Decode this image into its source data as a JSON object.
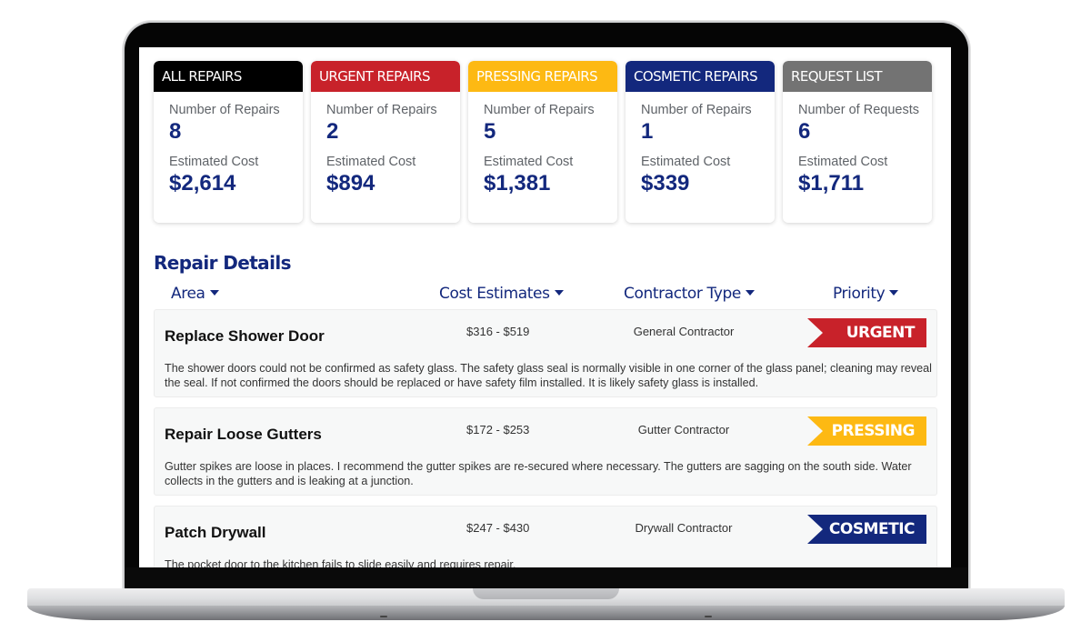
{
  "theme": {
    "all": "#000000",
    "urgent": "#c8222a",
    "pressing": "#fdb913",
    "cosmetic": "#13287d",
    "request": "#737373",
    "text_accent": "#13287d"
  },
  "summary_cards": [
    {
      "title": "ALL REPAIRS",
      "count_label": "Number of Repairs",
      "count": "8",
      "cost_label": "Estimated Cost",
      "cost": "$2,614"
    },
    {
      "title": "URGENT REPAIRS",
      "count_label": "Number of Repairs",
      "count": "2",
      "cost_label": "Estimated Cost",
      "cost": "$894"
    },
    {
      "title": "PRESSING REPAIRS",
      "count_label": "Number of Repairs",
      "count": "5",
      "cost_label": "Estimated Cost",
      "cost": "$1,381"
    },
    {
      "title": "COSMETIC REPAIRS",
      "count_label": "Number of Repairs",
      "count": "1",
      "cost_label": "Estimated Cost",
      "cost": "$339"
    },
    {
      "title": "REQUEST LIST",
      "count_label": "Number of Requests",
      "count": "6",
      "cost_label": "Estimated Cost",
      "cost": "$1,711"
    }
  ],
  "repair_details": {
    "title": "Repair Details",
    "columns": [
      {
        "label": "Area",
        "icon": "caret-down-icon"
      },
      {
        "label": "Cost Estimates",
        "icon": "caret-down-icon"
      },
      {
        "label": "Contractor Type",
        "icon": "caret-down-icon"
      },
      {
        "label": "Priority",
        "icon": "caret-down-icon"
      }
    ],
    "rows": [
      {
        "area": "Replace Shower Door",
        "cost": "$316 - $519",
        "contractor": "General Contractor",
        "priority": "URGENT",
        "description": "The shower doors could not be confirmed as safety glass. The safety glass seal is normally visible in one corner of the glass panel; cleaning may reveal the seal. If not confirmed the doors should be replaced or have safety film installed. It is likely safety glass is installed."
      },
      {
        "area": "Repair Loose Gutters",
        "cost": "$172 - $253",
        "contractor": "Gutter Contractor",
        "priority": "PRESSING",
        "description": "Gutter spikes are loose in places.  I recommend the gutter spikes are re-secured where necessary. The gutters are sagging on the south side.  Water collects in the gutters and is leaking at a junction."
      },
      {
        "area": "Patch Drywall",
        "cost": "$247 - $430",
        "contractor": "Drywall Contractor",
        "priority": "COSMETIC",
        "description": "The pocket door to the kitchen fails to slide easily and requires repair."
      }
    ]
  }
}
